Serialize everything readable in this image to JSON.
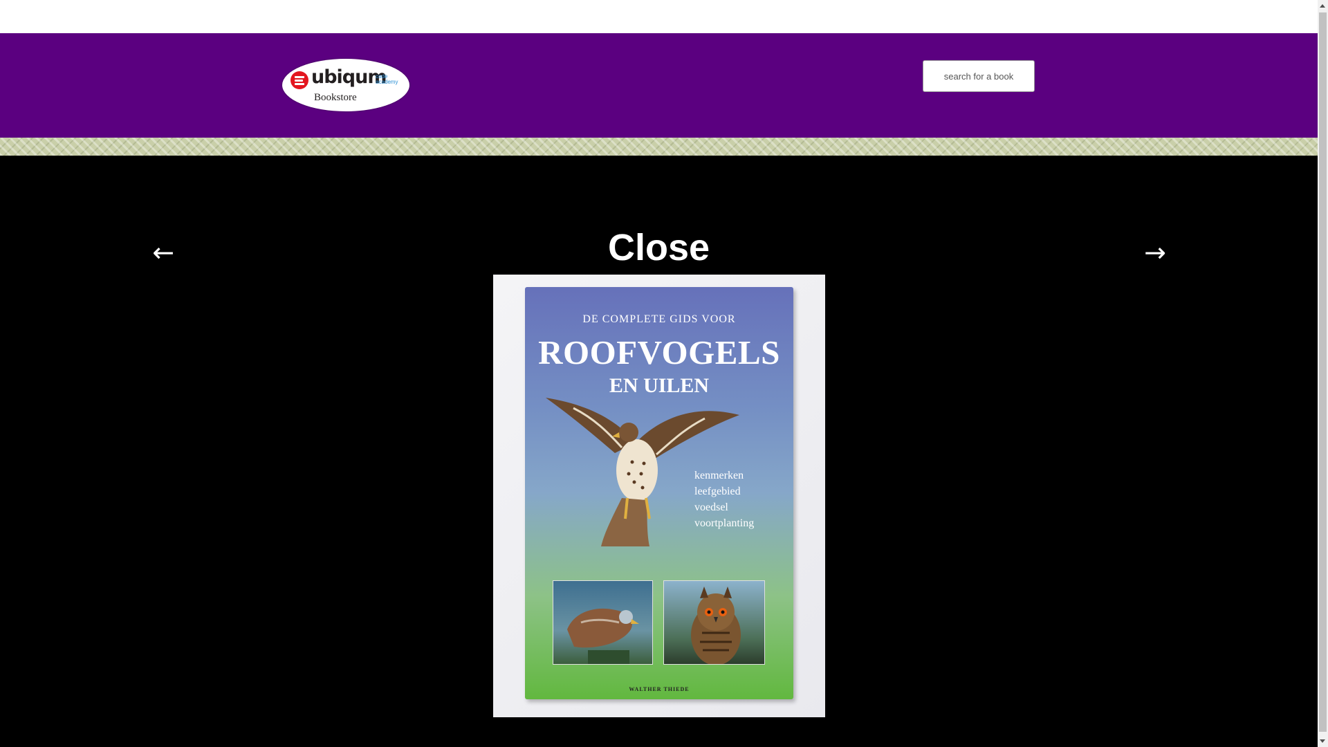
{
  "header": {
    "logo_word": "ubiqum",
    "logo_sub": "code academy",
    "logo_caption": "Bookstore",
    "search_placeholder": "search for a book",
    "colors": {
      "header_bg": "#5b0080",
      "logo_red": "#e3161f",
      "logo_blue": "#2a8fd4"
    }
  },
  "lightbox": {
    "close_label": "Close",
    "prev_label": "←",
    "next_label": "→",
    "book_cover": {
      "top_line": "DE COMPLETE GIDS VOOR",
      "title": "ROOFVOGELS",
      "subtitle": "EN UILEN",
      "features": [
        "kenmerken",
        "leefgebied",
        "voedsel",
        "voortplanting"
      ],
      "author": "WALTHER THIEDE",
      "icons": [
        "buzzard-illustration",
        "kite-photo",
        "owl-photo"
      ]
    }
  }
}
